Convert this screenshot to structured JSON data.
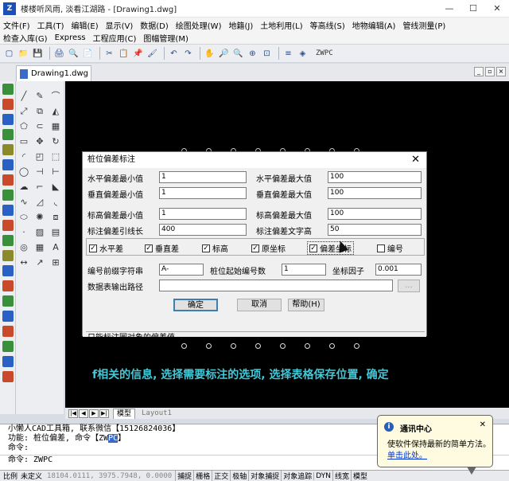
{
  "app": {
    "logo": "Z",
    "title": "楼楼听风雨, 淡看江湖路 - [Drawing1.dwg]",
    "window_buttons": [
      "—",
      "☐",
      "✕"
    ]
  },
  "menu": {
    "row1": [
      "文件(F)",
      "工具(T)",
      "编辑(E)",
      "显示(V)",
      "数据(D)",
      "绘图处理(W)",
      "地籍(J)",
      "土地利用(L)",
      "等高线(S)",
      "地物编辑(A)",
      "管线测量(P)"
    ],
    "row2": [
      "检查入库(G)",
      "Express",
      "工程应用(C)",
      "图幅管理(M)"
    ]
  },
  "toolbar": {
    "icons": [
      "▢",
      "📁",
      "💾",
      "🖨",
      "🔍",
      "📄",
      "✂",
      "📋",
      "📌",
      "🖌",
      "↶",
      "↷",
      "✋",
      "🔎",
      "🔍",
      "⊕",
      "⊡",
      "≡",
      "◈"
    ],
    "layer_name": "ZWPC"
  },
  "doctab": {
    "name": "Drawing1.dwg"
  },
  "drawing": {
    "caption": "f相关的信息, 选择需要标注的选项, 选择表格保存位置, 确定"
  },
  "layout_tabs": {
    "model": "模型",
    "layout": "Layout1"
  },
  "dialog": {
    "title": "桩位偏差标注",
    "close": "✕",
    "fields": {
      "h_min_label": "水平偏差最小值",
      "h_min_value": "1",
      "h_max_label": "水平偏差最大值",
      "h_max_value": "100",
      "v_min_label": "垂直偏差最小值",
      "v_min_value": "1",
      "v_max_label": "垂直偏差最大值",
      "v_max_value": "100",
      "e_min_label": "标高偏差最小值",
      "e_min_value": "1",
      "e_max_label": "标高偏差最大值",
      "e_max_value": "100",
      "leader_label": "标注偏差引线长",
      "leader_value": "400",
      "textheight_label": "标注偏差文字高",
      "textheight_value": "50"
    },
    "checkboxes": [
      {
        "label": "水平差",
        "checked": true
      },
      {
        "label": "垂直差",
        "checked": true
      },
      {
        "label": "标高",
        "checked": true
      },
      {
        "label": "原坐标",
        "checked": true
      },
      {
        "label": "偏差坐标",
        "checked": true
      },
      {
        "label": "编号",
        "checked": false
      }
    ],
    "prefix_label": "编号前缀字符串",
    "prefix_value": "A-",
    "start_label": "桩位起始编号数",
    "start_value": "1",
    "factor_label": "坐标因子",
    "factor_value": "0.001",
    "path_label": "数据表输出路径",
    "path_value": "",
    "browse": "...",
    "ok": "确定",
    "cancel": "取消",
    "help": "帮助(H)",
    "status": "只能标注圆对象的偏差值"
  },
  "command": {
    "line1": "小懒人CAD工具箱, 联系微信【15126824036】",
    "line2_prefix": "功能: 桩位偏差, 命令【ZW",
    "line2_hl": "PC",
    "line2_suffix": "】",
    "line3": "命令:",
    "line4": "命令: ZWPC"
  },
  "status": {
    "scale_label": "比例",
    "scale_value": "未定义",
    "coords": "18104.0111, 3975.7948, 0.0000",
    "buttons": [
      "捕捉",
      "栅格",
      "正交",
      "极轴",
      "对象捕捉",
      "对象追踪",
      "DYN",
      "线宽",
      "模型"
    ]
  },
  "notify": {
    "title": "通讯中心",
    "body": "使软件保持最新的简单方法。",
    "link": "单击此处。",
    "close": "✕"
  }
}
